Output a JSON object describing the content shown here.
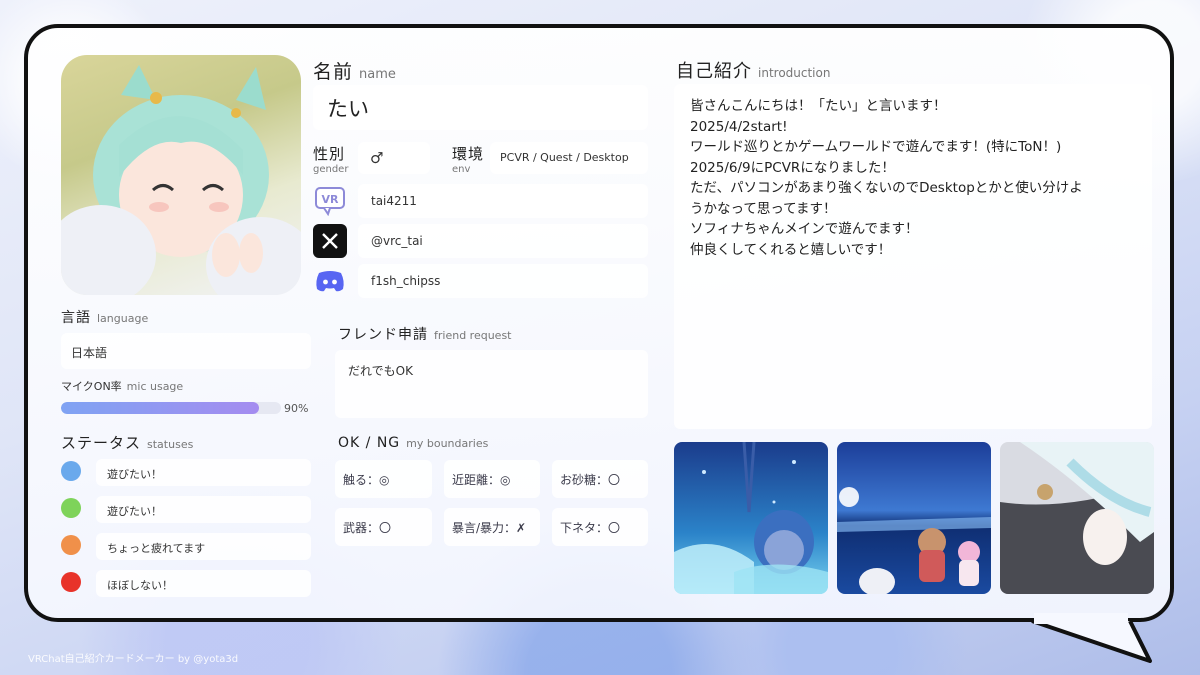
{
  "profile": {
    "name_jp": "名前",
    "name_en": "name",
    "name_value": "たい",
    "gender_jp": "性別",
    "gender_en": "gender",
    "gender_value": "♂",
    "env_jp": "環境",
    "env_en": "env",
    "env_value": "PCVR / Quest / Desktop"
  },
  "accounts": [
    {
      "icon": "vrchat-icon",
      "value": "tai4211"
    },
    {
      "icon": "x-twitter-icon",
      "value": "@vrc_tai"
    },
    {
      "icon": "discord-icon",
      "value": "f1sh_chipss"
    }
  ],
  "language": {
    "label_jp": "言語",
    "label_en": "language",
    "value": "日本語"
  },
  "mic": {
    "label_jp": "マイクON率",
    "label_en": "mic usage",
    "percent": 90,
    "percent_text": "90%"
  },
  "statuses": {
    "label_jp": "ステータス",
    "label_en": "statuses",
    "items": [
      {
        "color": "#6aa9ec",
        "text": "遊びたい！"
      },
      {
        "color": "#7ed35a",
        "text": "遊びたい！"
      },
      {
        "color": "#f0904a",
        "text": "ちょっと疲れてます"
      },
      {
        "color": "#e8332a",
        "text": "ほぼしない！"
      }
    ]
  },
  "friend_request": {
    "label_jp": "フレンド申請",
    "label_en": "friend request",
    "value": "だれでもOK"
  },
  "boundaries": {
    "label_jp": "OK / NG",
    "label_en": "my boundaries",
    "items": [
      "触る：◎",
      "近距離：◎",
      "お砂糖：〇",
      "武器：〇",
      "暴言/暴力：✗",
      "下ネタ：〇"
    ]
  },
  "introduction": {
    "label_jp": "自己紹介",
    "label_en": "introduction",
    "lines": [
      "皆さんこんにちは！「たい」と言います！",
      "2025/4/2start!",
      "ワールド巡りとかゲームワールドで遊んでます！(特にToN！)",
      "2025/6/9にPCVRになりました！",
      "ただ、パソコンがあまり強くないのでDesktopとかと使い分けよ",
      "うかなって思ってます！",
      "ソフィナちゃんメインで遊んでます！",
      "仲良くしてくれると嬉しいです！"
    ]
  },
  "footer": "VRChat自己紹介カードメーカー by @yota3d",
  "colors": {
    "mic_bar_start": "#7fa3f3",
    "mic_bar_end": "#a58cf0",
    "discord": "#5865f2"
  }
}
